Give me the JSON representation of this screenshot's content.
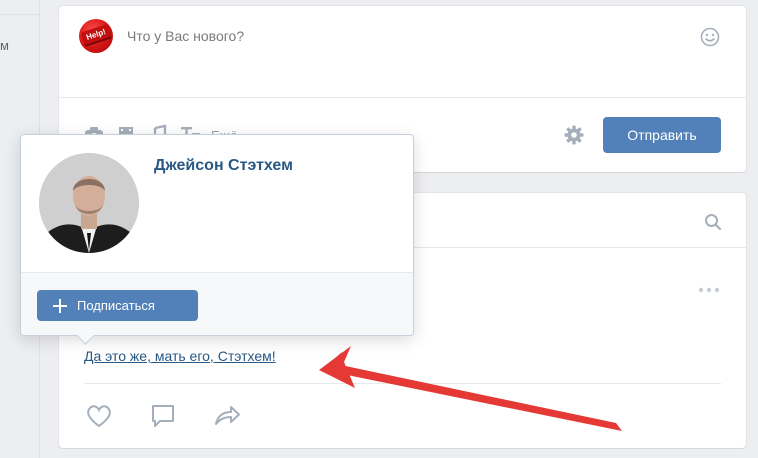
{
  "composer": {
    "placeholder": "Что у Вас нового?",
    "avatar_text": "Help!",
    "more_label": "Ещё",
    "send_label": "Отправить"
  },
  "popup": {
    "name": "Джейсон Стэтхем",
    "subscribe_label": "Подписаться"
  },
  "post": {
    "link_text": "Да это же, мать его, Стэтхем!"
  },
  "icons": {
    "emoji": "smile-icon",
    "photo": "camera-icon",
    "video": "video-icon",
    "music": "music-icon",
    "text": "text-icon",
    "settings": "gear-icon",
    "search": "search-icon",
    "more": "more-dots-icon",
    "like": "heart-icon",
    "comment": "comment-icon",
    "share": "share-icon",
    "add": "plus-icon"
  },
  "colors": {
    "accent": "#5181b8",
    "link": "#2a5885",
    "annotation_arrow": "#e53935"
  },
  "left_stub_text": "м"
}
